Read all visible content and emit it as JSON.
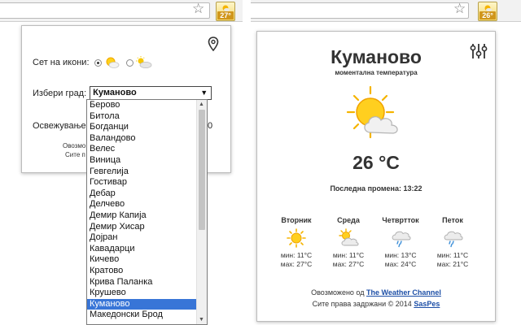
{
  "left": {
    "badge": "27°",
    "icon_set_label": "Сет на икони:",
    "choose_city_label": "Избери град:",
    "selected_city": "Куманово",
    "refresh_label": "Освежување",
    "refresh_value": "0",
    "footer_line1": "Овозмо",
    "footer_line2": "Сите п",
    "cities": [
      "Берово",
      "Битола",
      "Богданци",
      "Валандово",
      "Велес",
      "Виница",
      "Гевгелија",
      "Гостивар",
      "Дебар",
      "Делчево",
      "Демир Капија",
      "Демир Хисар",
      "Дојран",
      "Кавадарци",
      "Кичево",
      "Кратово",
      "Крива Паланка",
      "Крушево",
      "Куманово",
      "Македонски Брод"
    ],
    "selected_index": 18
  },
  "right": {
    "badge": "26°",
    "city": "Куманово",
    "subtitle": "моментална температура",
    "temperature": "26 °C",
    "updated_label": "Последна промена:",
    "updated_time": "13:22",
    "forecast": [
      {
        "day": "Вторник",
        "icon": "sun-icon",
        "min": "мин: 11°C",
        "max": "мах: 27°C"
      },
      {
        "day": "Среда",
        "icon": "partly-cloudy-icon",
        "min": "мин: 11°C",
        "max": "мах: 27°C"
      },
      {
        "day": "Четвртток",
        "icon": "rain-cloud-icon",
        "min": "мин: 13°C",
        "max": "мах: 24°C"
      },
      {
        "day": "Петок",
        "icon": "rain-cloud-icon",
        "min": "мин: 11°C",
        "max": "мах: 21°C"
      }
    ],
    "credit_prefix": "Овозможено од",
    "credit_link": "The Weather Channel",
    "copyright_prefix": "Сите права задржани © 2014",
    "copyright_link": "SasPes"
  },
  "colors": {
    "badge": "#d0961b",
    "selection": "#3875d7",
    "link": "#1c4ea6"
  }
}
